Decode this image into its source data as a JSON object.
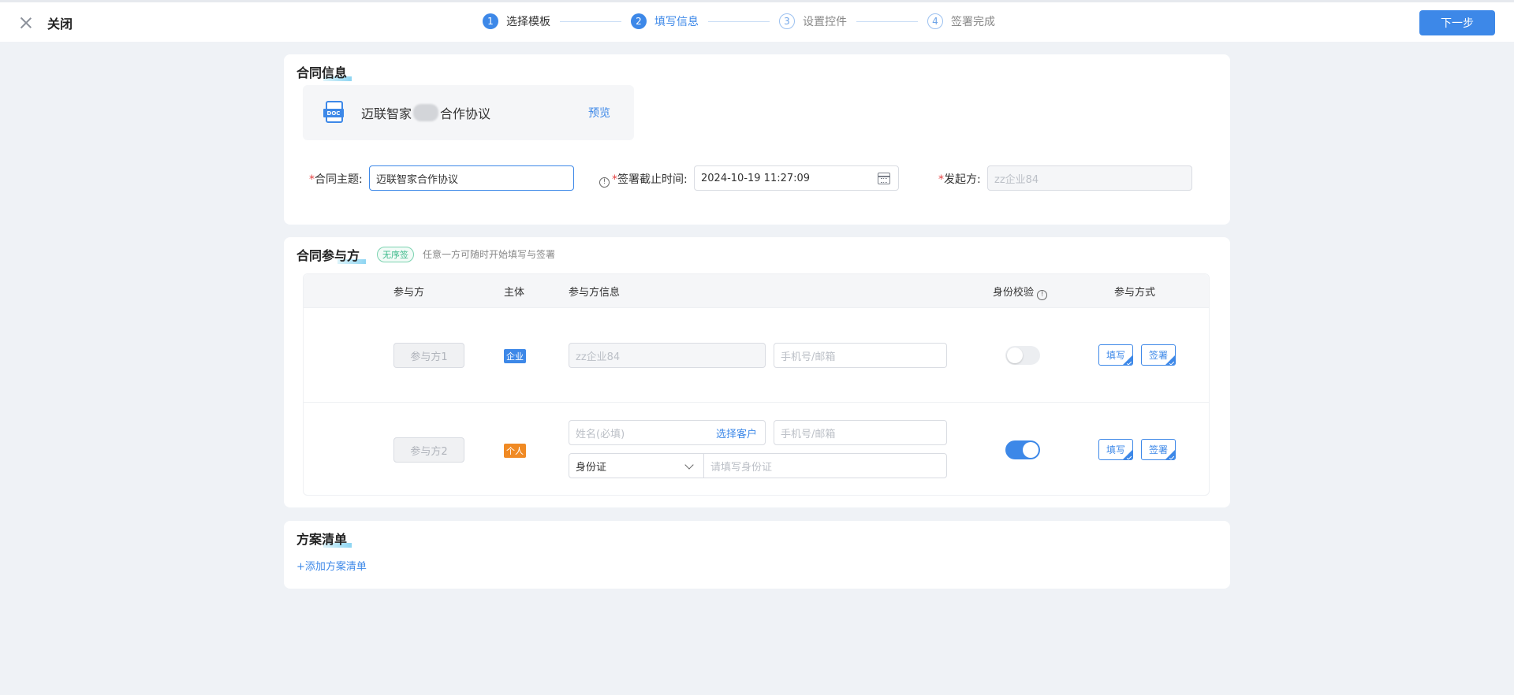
{
  "header": {
    "close_label": "关闭",
    "next_label": "下一步",
    "steps": [
      {
        "num": "1",
        "label": "选择模板"
      },
      {
        "num": "2",
        "label": "填写信息"
      },
      {
        "num": "3",
        "label": "设置控件"
      },
      {
        "num": "4",
        "label": "签署完成"
      }
    ],
    "current_step": 2
  },
  "contract": {
    "title": "合同信息",
    "doc_icon_text": "DOC",
    "doc_name_part1": "迈联智家",
    "doc_name_part2": "合作协议",
    "preview_label": "预览",
    "subject_label": "合同主题:",
    "subject_value": "迈联智家合作协议",
    "deadline_label": "签署截止时间:",
    "deadline_value": "2024-10-19 11:27:09",
    "initiator_label": "发起方:",
    "initiator_placeholder": "zz企业84"
  },
  "parties": {
    "title": "合同参与方",
    "order_badge": "无序签",
    "hint": "任意一方可随时开始填写与签署",
    "columns": {
      "party": "参与方",
      "subject": "主体",
      "info": "参与方信息",
      "verify": "身份校验",
      "mode": "参与方式"
    },
    "rows": [
      {
        "party_label": "参与方1",
        "type_tag": "企业",
        "company_placeholder": "zz企业84",
        "contact_placeholder": "手机号/邮箱",
        "verify_on": false,
        "fill_label": "填写",
        "sign_label": "签署"
      },
      {
        "party_label": "参与方2",
        "type_tag": "个人",
        "name_placeholder": "姓名(必填)",
        "select_customer_label": "选择客户",
        "contact_placeholder": "手机号/邮箱",
        "id_type": "身份证",
        "id_placeholder": "请填写身份证",
        "verify_on": true,
        "fill_label": "填写",
        "sign_label": "签署"
      }
    ]
  },
  "plan": {
    "title": "方案清单",
    "add_label": "+添加方案清单"
  },
  "colors": {
    "accent": "#3d88e8",
    "required": "#e54545",
    "person_tag": "#f08a24",
    "order_badge": "#3bb98a"
  }
}
